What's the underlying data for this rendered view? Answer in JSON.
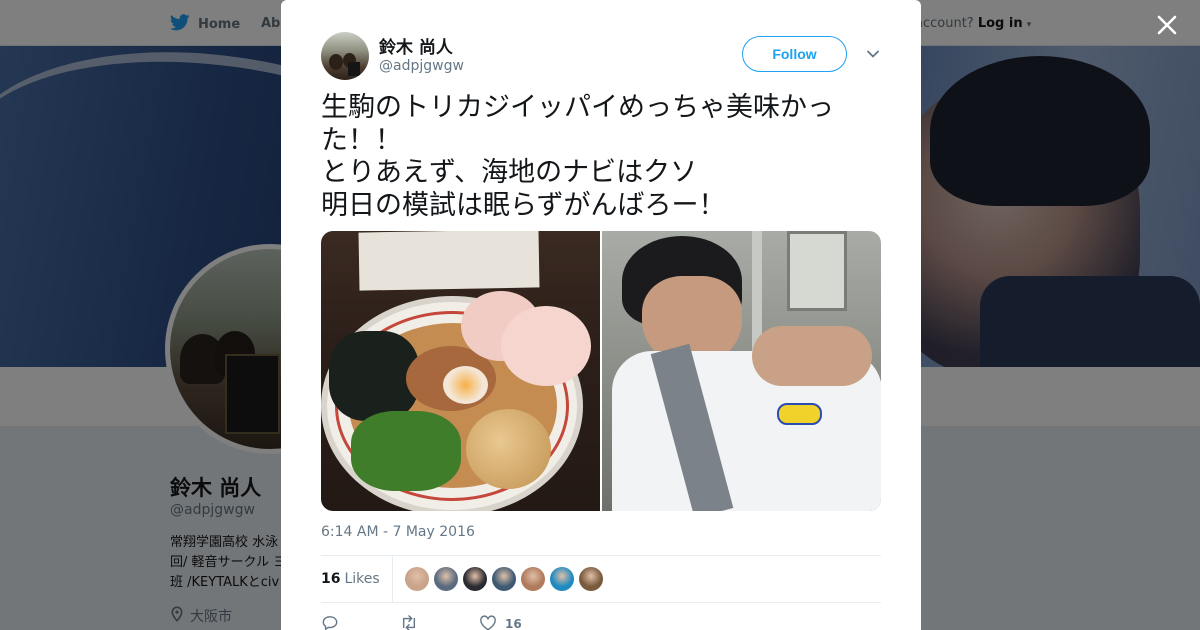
{
  "topnav": {
    "home_label": "Home",
    "about_label": "Abo",
    "account_prompt": "account?",
    "login_label": "Log in"
  },
  "profile": {
    "name": "鈴木 尚人",
    "handle": "@adpjgwgw",
    "bio_lines": [
      "常翔学園高校 水泳",
      "回/ 軽音サークル ヨ",
      "班 /KEYTALKとciv"
    ],
    "location": "大阪市"
  },
  "tweet": {
    "author_name": "鈴木 尚人",
    "author_handle": "@adpjgwgw",
    "follow_label": "Follow",
    "text_lines": [
      "生駒のトリカジイッパイめっちゃ美味かっ",
      "た！！",
      "とりあえず、海地のナビはクソ",
      "明日の模試は眠らずがんばろー！"
    ],
    "timestamp": "6:14 AM - 7 May 2016",
    "likes_count": "16",
    "likes_label": "Likes",
    "like_action_count": "16"
  },
  "icons": {
    "close": "close-icon",
    "caret": "chevron-down-icon",
    "bird": "twitter-bird-icon",
    "reply": "reply-icon",
    "retweet": "retweet-icon",
    "like": "heart-icon",
    "location": "location-pin-icon"
  },
  "colors": {
    "brand_blue": "#1da1f2",
    "text_primary": "#14171a",
    "text_secondary": "#657786",
    "overlay": "rgba(0,0,0,0.5)"
  },
  "likers": [
    {
      "color": "#c9a38a"
    },
    {
      "color": "#5a6b80"
    },
    {
      "color": "#2b2b33"
    },
    {
      "color": "#3d5a72"
    },
    {
      "color": "#b07a5c"
    },
    {
      "color": "#1f8ac0"
    },
    {
      "color": "#7a5a3c"
    }
  ]
}
